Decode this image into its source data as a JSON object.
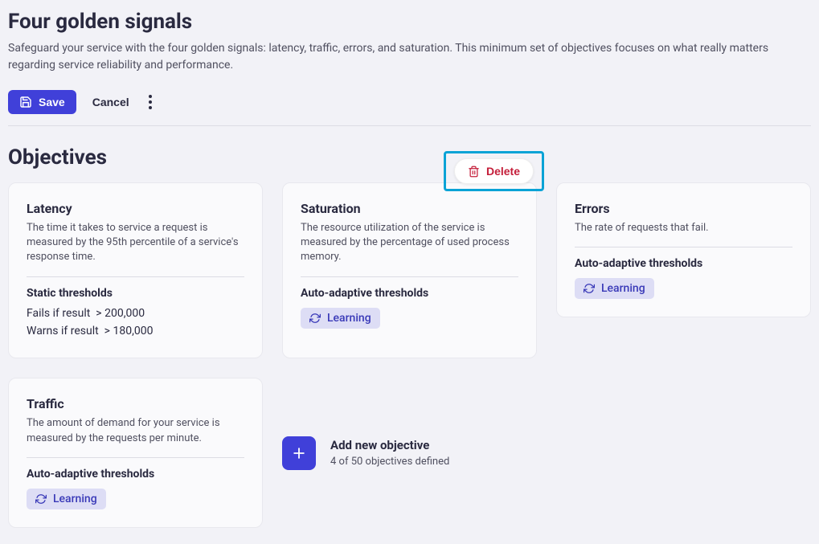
{
  "header": {
    "title": "Four golden signals",
    "description": "Safeguard your service with the four golden signals: latency, traffic, errors, and saturation. This minimum set of objectives focuses on what really matters regarding service reliability and performance."
  },
  "toolbar": {
    "save": "Save",
    "cancel": "Cancel"
  },
  "section": {
    "title": "Objectives"
  },
  "objectives": {
    "latency": {
      "title": "Latency",
      "desc": "The time it takes to service a request is measured by the 95th percentile of a service's response time.",
      "threshold_type": "Static thresholds",
      "fails_label": "Fails if result",
      "fails_op": ">",
      "fails_value": "200,000",
      "warns_label": "Warns if result",
      "warns_op": ">",
      "warns_value": "180,000"
    },
    "saturation": {
      "title": "Saturation",
      "desc": "The resource utilization of the service is measured by the percentage of used process memory.",
      "threshold_type": "Auto-adaptive thresholds",
      "badge": "Learning"
    },
    "errors": {
      "title": "Errors",
      "desc": "The rate of requests that fail.",
      "threshold_type": "Auto-adaptive thresholds",
      "badge": "Learning"
    },
    "traffic": {
      "title": "Traffic",
      "desc": "The amount of demand for your service is measured by the requests per minute.",
      "threshold_type": "Auto-adaptive thresholds",
      "badge": "Learning"
    }
  },
  "delete_label": "Delete",
  "add": {
    "title": "Add new objective",
    "subtitle": "4 of 50 objectives defined"
  }
}
